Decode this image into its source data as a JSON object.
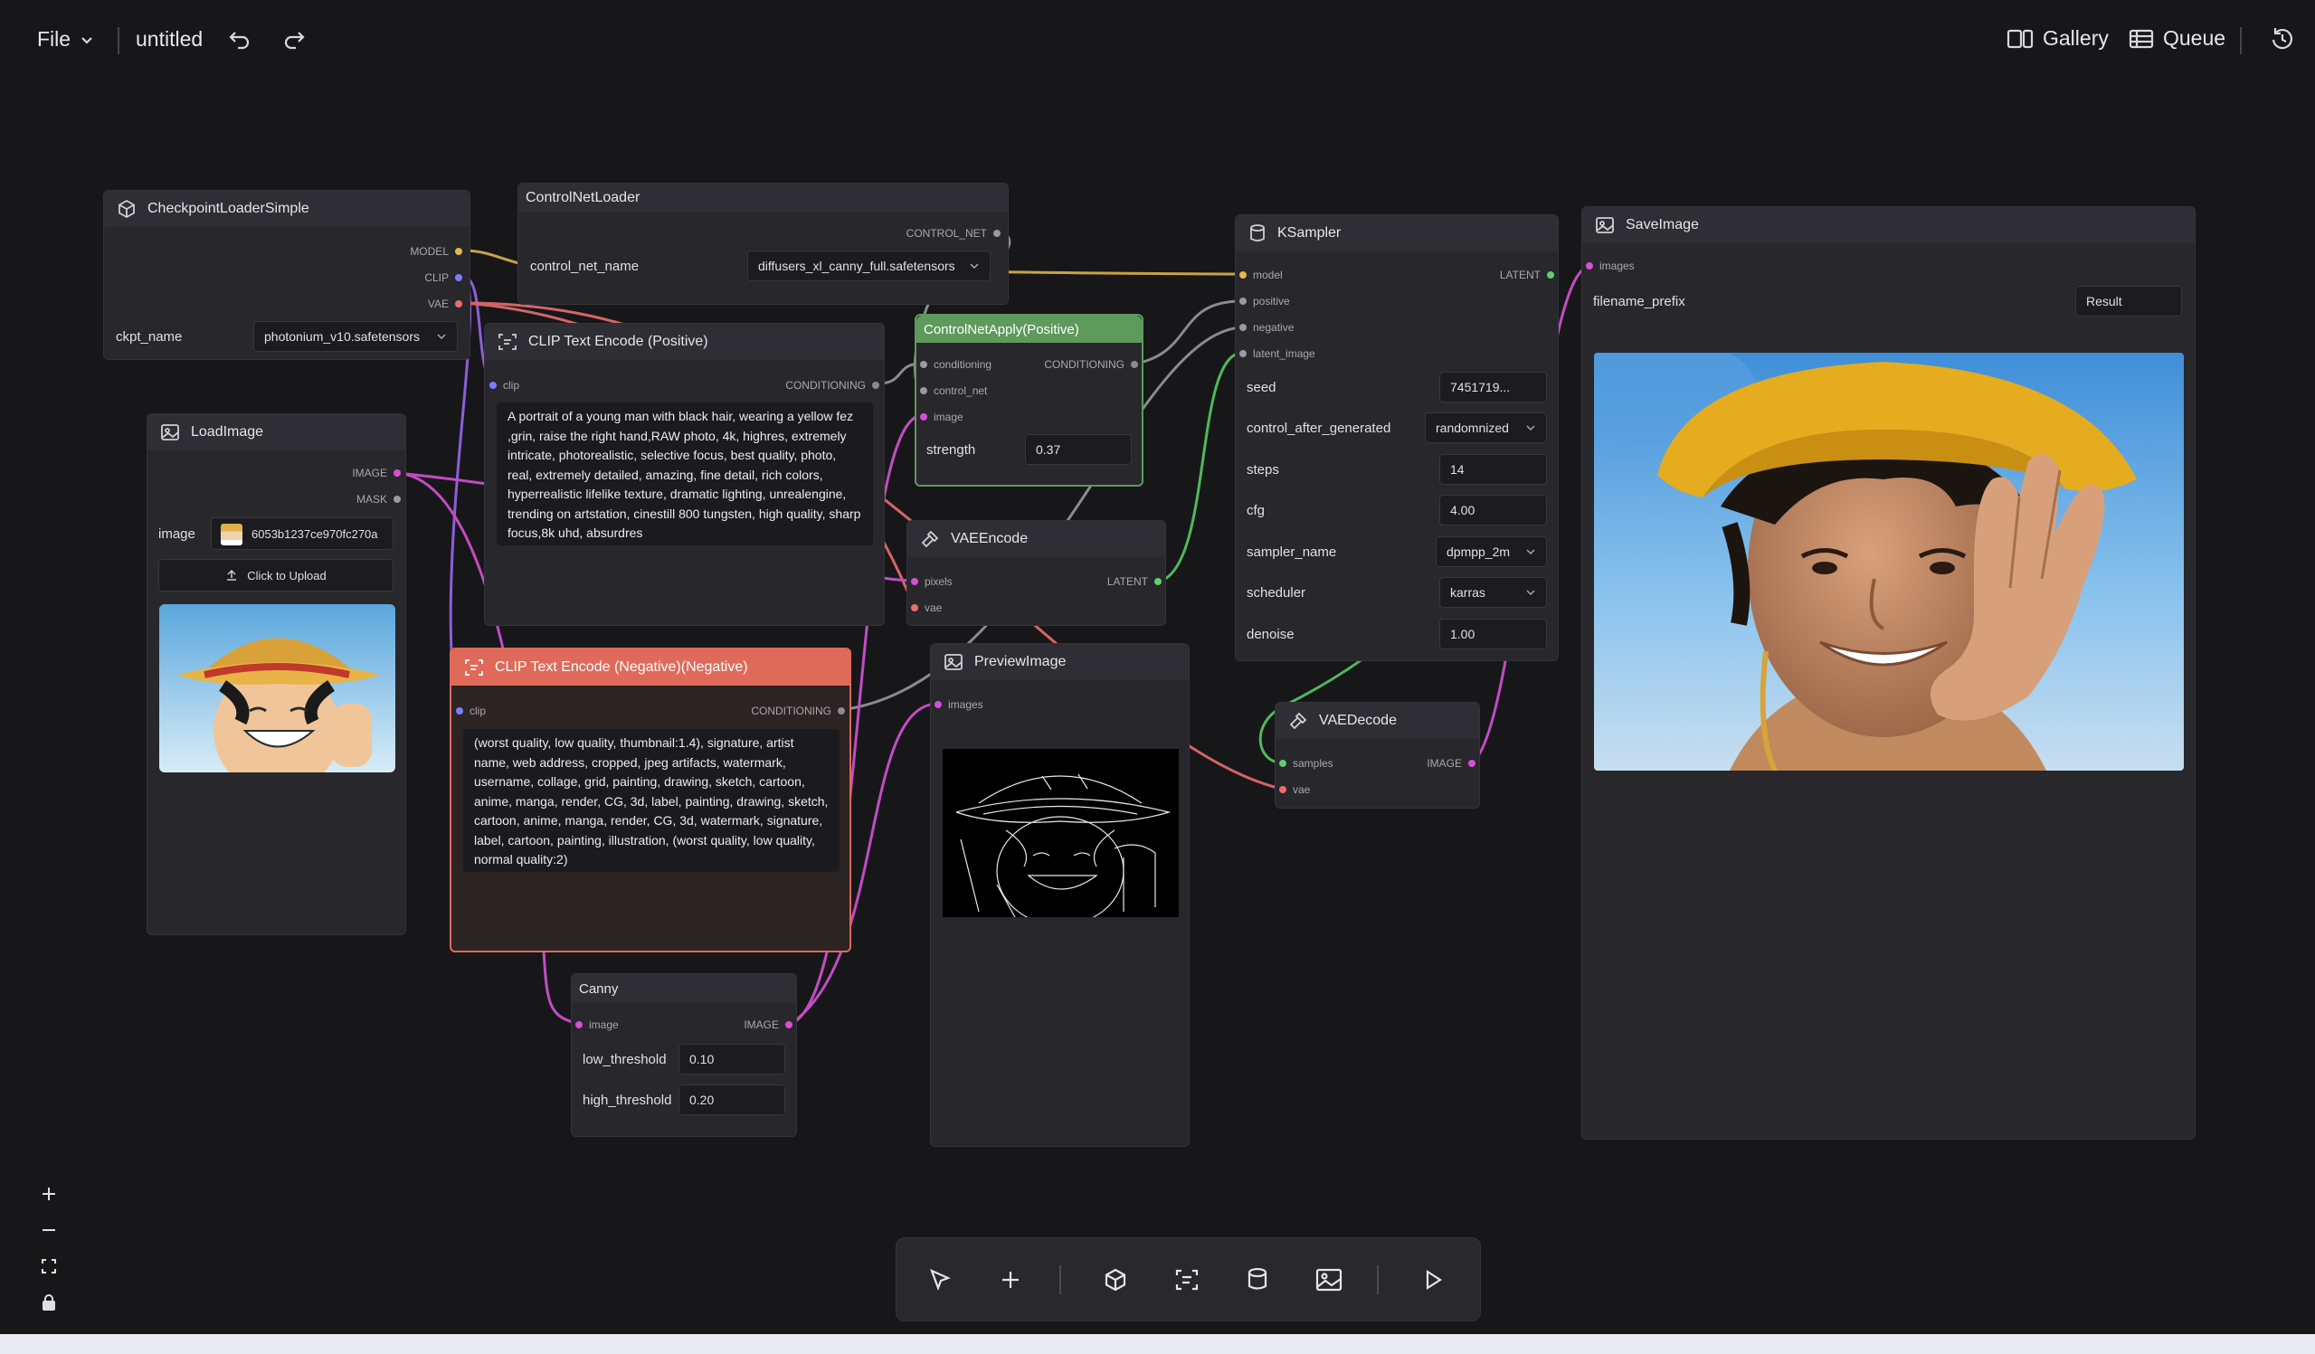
{
  "topbar": {
    "file_menu": "File",
    "workflow_name": "untitled",
    "gallery_label": "Gallery",
    "queue_label": "Queue"
  },
  "nodes": {
    "checkpoint": {
      "title": "CheckpointLoaderSimple",
      "outputs": [
        "MODEL",
        "CLIP",
        "VAE"
      ],
      "ckpt_label": "ckpt_name",
      "ckpt_value": "photonium_v10.safetensors"
    },
    "controlnet_loader": {
      "title": "ControlNetLoader",
      "output": "CONTROL_NET",
      "name_label": "control_net_name",
      "name_value": "diffusers_xl_canny_full.safetensors"
    },
    "clip_pos": {
      "title": "CLIP Text Encode (Positive)",
      "input": "clip",
      "output": "CONDITIONING",
      "text": "A portrait of a young man with black hair, wearing a yellow fez ,grin, raise the right hand,RAW photo, 4k, highres, extremely intricate, photorealistic, selective focus, best quality, photo, real, extremely detailed, amazing, fine detail, rich colors, hyperrealistic lifelike texture, dramatic lighting, unrealengine, trending on artstation, cinestill 800 tungsten, high quality, sharp focus,8k uhd, absurdres"
    },
    "clip_neg": {
      "title": "CLIP Text Encode (Negative)(Negative)",
      "input": "clip",
      "output": "CONDITIONING",
      "text": "(worst quality, low quality, thumbnail:1.4), signature, artist name, web address, cropped, jpeg artifacts, watermark, username, collage, grid, painting, drawing, sketch, cartoon, anime, manga, render, CG, 3d, label, painting, drawing, sketch, cartoon, anime, manga, render, CG, 3d, watermark, signature, label, cartoon, painting, illustration, (worst quality, low quality, normal quality:2)"
    },
    "load_image": {
      "title": "LoadImage",
      "outputs": [
        "IMAGE",
        "MASK"
      ],
      "image_label": "image",
      "image_value": "6053b1237ce970fc270a",
      "upload_label": "Click to Upload"
    },
    "controlnet_apply": {
      "title": "ControlNetApply(Positive)",
      "inputs": [
        "conditioning",
        "control_net",
        "image"
      ],
      "output": "CONDITIONING",
      "strength_label": "strength",
      "strength_value": "0.37"
    },
    "vae_encode": {
      "title": "VAEEncode",
      "inputs": [
        "pixels",
        "vae"
      ],
      "output": "LATENT"
    },
    "preview": {
      "title": "PreviewImage",
      "input": "images"
    },
    "canny": {
      "title": "Canny",
      "input": "image",
      "output": "IMAGE",
      "low_label": "low_threshold",
      "low_value": "0.10",
      "high_label": "high_threshold",
      "high_value": "0.20"
    },
    "ksampler": {
      "title": "KSampler",
      "inputs": [
        "model",
        "positive",
        "negative",
        "latent_image"
      ],
      "output": "LATENT",
      "widgets": [
        {
          "label": "seed",
          "value": "7451719..."
        },
        {
          "label": "control_after_generated",
          "value": "randomnized"
        },
        {
          "label": "steps",
          "value": "14"
        },
        {
          "label": "cfg",
          "value": "4.00"
        },
        {
          "label": "sampler_name",
          "value": "dpmpp_2m"
        },
        {
          "label": "scheduler",
          "value": "karras"
        },
        {
          "label": "denoise",
          "value": "1.00"
        }
      ]
    },
    "vae_decode": {
      "title": "VAEDecode",
      "inputs": [
        "samples",
        "vae"
      ],
      "output": "IMAGE"
    },
    "save_image": {
      "title": "SaveImage",
      "input": "images",
      "prefix_label": "filename_prefix",
      "prefix_value": "Result"
    }
  },
  "colors": {
    "model": "#e6b64c",
    "clip": "#a66bf0",
    "vae": "#f06b6b",
    "image": "#d64fd6",
    "conditioning": "#8a8a90",
    "latent": "#5fcf6a",
    "negative_header": "#e06a5a",
    "controlnet_header": "#5d9a5c"
  }
}
